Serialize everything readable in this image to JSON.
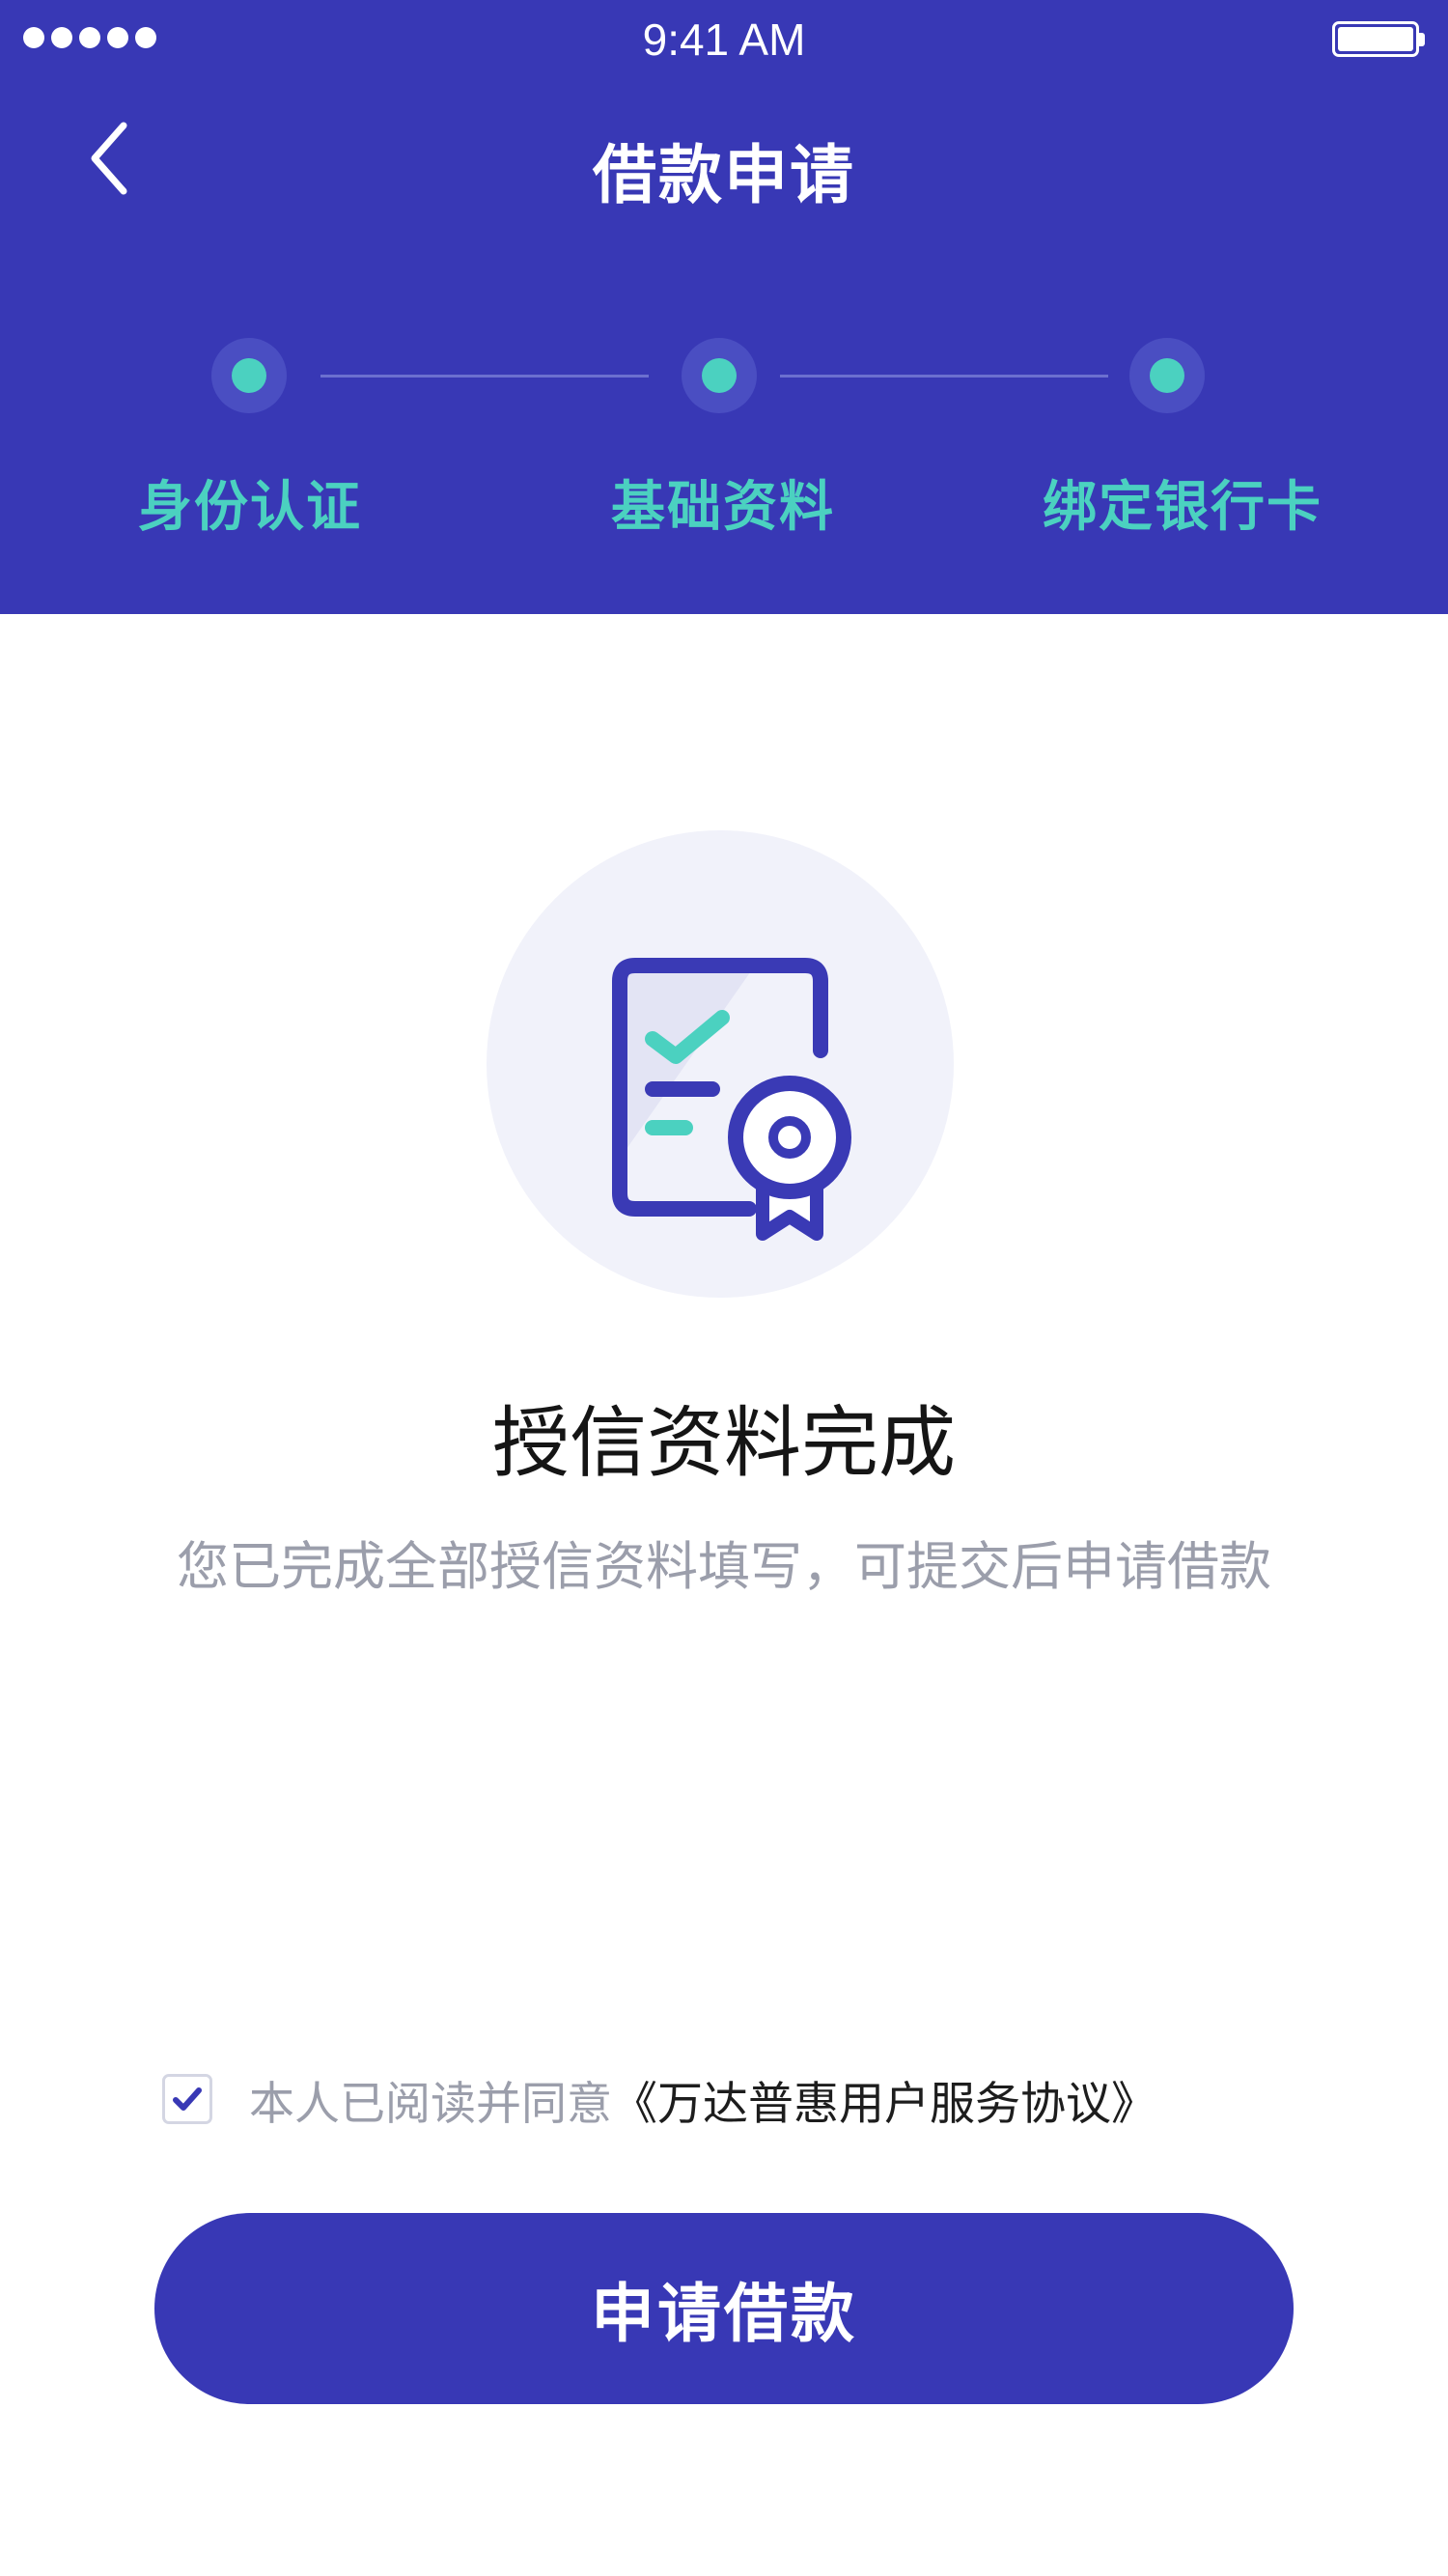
{
  "status_bar": {
    "time": "9:41 AM"
  },
  "nav": {
    "title": "借款申请"
  },
  "steps": [
    {
      "label": "身份认证"
    },
    {
      "label": "基础资料"
    },
    {
      "label": "绑定银行卡"
    }
  ],
  "main": {
    "title": "授信资料完成",
    "subtitle": "您已完成全部授信资料填写，可提交后申请借款"
  },
  "agreement": {
    "prefix": "本人已阅读并同意",
    "link": "《万达普惠用户服务协议》",
    "checked": true
  },
  "submit": {
    "label": "申请借款"
  },
  "icons": {
    "back": "chevron-left-icon",
    "checkbox": "check-icon",
    "illustration": "certified-document-icon"
  },
  "colors": {
    "brand": "#3838b5",
    "accent": "#4bd1c0",
    "muted_text": "#9b9eab"
  }
}
